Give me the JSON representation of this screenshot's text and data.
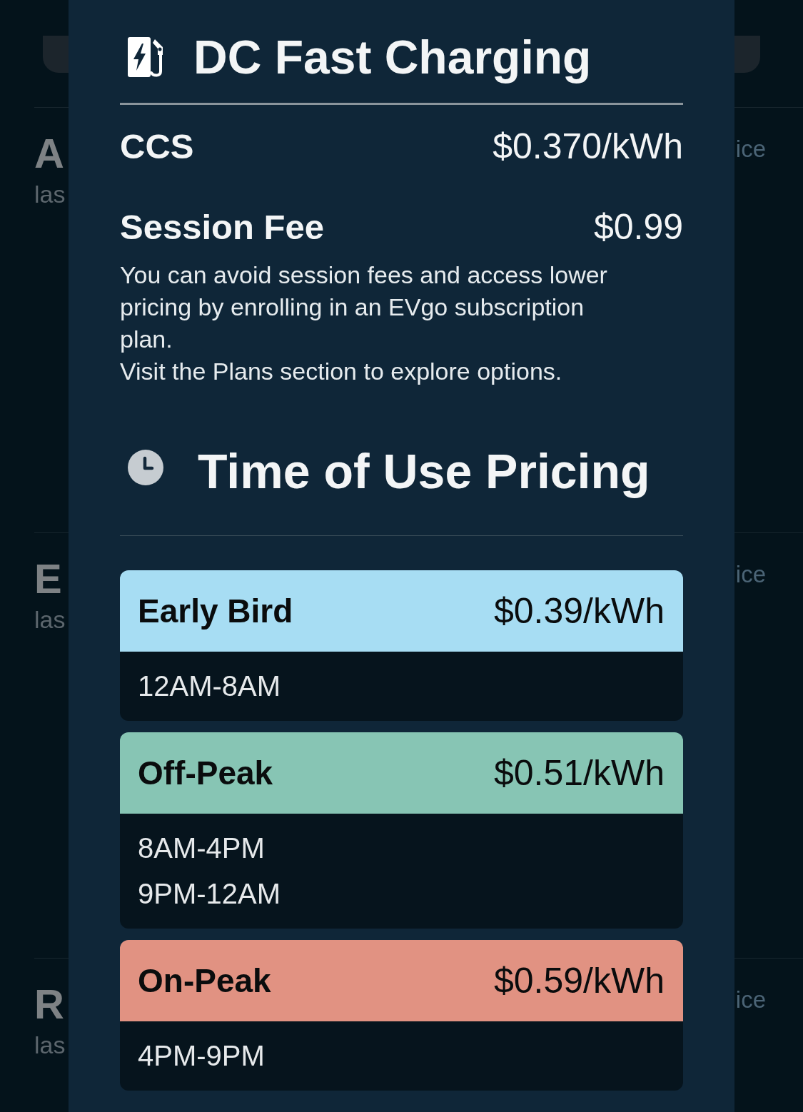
{
  "background": {
    "rows": [
      {
        "title": "A",
        "subtitle": "las",
        "trailing": "ice"
      },
      {
        "title": "E",
        "subtitle": "las",
        "trailing": "ice"
      },
      {
        "title": "R",
        "subtitle": "las",
        "trailing": "ice"
      }
    ]
  },
  "dialog": {
    "title": "DC Fast Charging",
    "connector": {
      "label": "CCS",
      "price": "$0.370/kWh"
    },
    "session_fee": {
      "label": "Session Fee",
      "price": "$0.99"
    },
    "description": [
      "You can avoid session fees and access lower pricing by enrolling in an EVgo subscription plan.",
      "Visit the Plans section to explore options."
    ]
  },
  "time_of_use": {
    "title": "Time of Use Pricing",
    "periods": [
      {
        "name": "Early Bird",
        "price": "$0.39/kWh",
        "color": "#a7ddf3",
        "times": [
          "12AM-8AM"
        ]
      },
      {
        "name": "Off-Peak",
        "price": "$0.51/kWh",
        "color": "#87c5b4",
        "times": [
          "8AM-4PM",
          "9PM-12AM"
        ]
      },
      {
        "name": "On-Peak",
        "price": "$0.59/kWh",
        "color": "#e19282",
        "times": [
          "4PM-9PM"
        ]
      }
    ]
  }
}
